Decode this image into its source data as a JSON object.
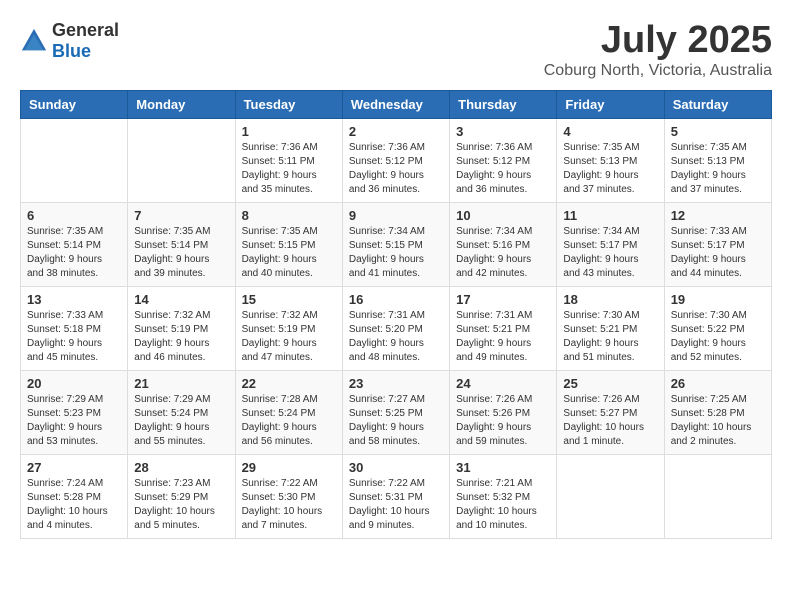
{
  "header": {
    "logo_general": "General",
    "logo_blue": "Blue",
    "month_year": "July 2025",
    "location": "Coburg North, Victoria, Australia"
  },
  "days_of_week": [
    "Sunday",
    "Monday",
    "Tuesday",
    "Wednesday",
    "Thursday",
    "Friday",
    "Saturday"
  ],
  "weeks": [
    [
      {
        "day": "",
        "info": ""
      },
      {
        "day": "",
        "info": ""
      },
      {
        "day": "1",
        "info": "Sunrise: 7:36 AM\nSunset: 5:11 PM\nDaylight: 9 hours\nand 35 minutes."
      },
      {
        "day": "2",
        "info": "Sunrise: 7:36 AM\nSunset: 5:12 PM\nDaylight: 9 hours\nand 36 minutes."
      },
      {
        "day": "3",
        "info": "Sunrise: 7:36 AM\nSunset: 5:12 PM\nDaylight: 9 hours\nand 36 minutes."
      },
      {
        "day": "4",
        "info": "Sunrise: 7:35 AM\nSunset: 5:13 PM\nDaylight: 9 hours\nand 37 minutes."
      },
      {
        "day": "5",
        "info": "Sunrise: 7:35 AM\nSunset: 5:13 PM\nDaylight: 9 hours\nand 37 minutes."
      }
    ],
    [
      {
        "day": "6",
        "info": "Sunrise: 7:35 AM\nSunset: 5:14 PM\nDaylight: 9 hours\nand 38 minutes."
      },
      {
        "day": "7",
        "info": "Sunrise: 7:35 AM\nSunset: 5:14 PM\nDaylight: 9 hours\nand 39 minutes."
      },
      {
        "day": "8",
        "info": "Sunrise: 7:35 AM\nSunset: 5:15 PM\nDaylight: 9 hours\nand 40 minutes."
      },
      {
        "day": "9",
        "info": "Sunrise: 7:34 AM\nSunset: 5:15 PM\nDaylight: 9 hours\nand 41 minutes."
      },
      {
        "day": "10",
        "info": "Sunrise: 7:34 AM\nSunset: 5:16 PM\nDaylight: 9 hours\nand 42 minutes."
      },
      {
        "day": "11",
        "info": "Sunrise: 7:34 AM\nSunset: 5:17 PM\nDaylight: 9 hours\nand 43 minutes."
      },
      {
        "day": "12",
        "info": "Sunrise: 7:33 AM\nSunset: 5:17 PM\nDaylight: 9 hours\nand 44 minutes."
      }
    ],
    [
      {
        "day": "13",
        "info": "Sunrise: 7:33 AM\nSunset: 5:18 PM\nDaylight: 9 hours\nand 45 minutes."
      },
      {
        "day": "14",
        "info": "Sunrise: 7:32 AM\nSunset: 5:19 PM\nDaylight: 9 hours\nand 46 minutes."
      },
      {
        "day": "15",
        "info": "Sunrise: 7:32 AM\nSunset: 5:19 PM\nDaylight: 9 hours\nand 47 minutes."
      },
      {
        "day": "16",
        "info": "Sunrise: 7:31 AM\nSunset: 5:20 PM\nDaylight: 9 hours\nand 48 minutes."
      },
      {
        "day": "17",
        "info": "Sunrise: 7:31 AM\nSunset: 5:21 PM\nDaylight: 9 hours\nand 49 minutes."
      },
      {
        "day": "18",
        "info": "Sunrise: 7:30 AM\nSunset: 5:21 PM\nDaylight: 9 hours\nand 51 minutes."
      },
      {
        "day": "19",
        "info": "Sunrise: 7:30 AM\nSunset: 5:22 PM\nDaylight: 9 hours\nand 52 minutes."
      }
    ],
    [
      {
        "day": "20",
        "info": "Sunrise: 7:29 AM\nSunset: 5:23 PM\nDaylight: 9 hours\nand 53 minutes."
      },
      {
        "day": "21",
        "info": "Sunrise: 7:29 AM\nSunset: 5:24 PM\nDaylight: 9 hours\nand 55 minutes."
      },
      {
        "day": "22",
        "info": "Sunrise: 7:28 AM\nSunset: 5:24 PM\nDaylight: 9 hours\nand 56 minutes."
      },
      {
        "day": "23",
        "info": "Sunrise: 7:27 AM\nSunset: 5:25 PM\nDaylight: 9 hours\nand 58 minutes."
      },
      {
        "day": "24",
        "info": "Sunrise: 7:26 AM\nSunset: 5:26 PM\nDaylight: 9 hours\nand 59 minutes."
      },
      {
        "day": "25",
        "info": "Sunrise: 7:26 AM\nSunset: 5:27 PM\nDaylight: 10 hours\nand 1 minute."
      },
      {
        "day": "26",
        "info": "Sunrise: 7:25 AM\nSunset: 5:28 PM\nDaylight: 10 hours\nand 2 minutes."
      }
    ],
    [
      {
        "day": "27",
        "info": "Sunrise: 7:24 AM\nSunset: 5:28 PM\nDaylight: 10 hours\nand 4 minutes."
      },
      {
        "day": "28",
        "info": "Sunrise: 7:23 AM\nSunset: 5:29 PM\nDaylight: 10 hours\nand 5 minutes."
      },
      {
        "day": "29",
        "info": "Sunrise: 7:22 AM\nSunset: 5:30 PM\nDaylight: 10 hours\nand 7 minutes."
      },
      {
        "day": "30",
        "info": "Sunrise: 7:22 AM\nSunset: 5:31 PM\nDaylight: 10 hours\nand 9 minutes."
      },
      {
        "day": "31",
        "info": "Sunrise: 7:21 AM\nSunset: 5:32 PM\nDaylight: 10 hours\nand 10 minutes."
      },
      {
        "day": "",
        "info": ""
      },
      {
        "day": "",
        "info": ""
      }
    ]
  ]
}
